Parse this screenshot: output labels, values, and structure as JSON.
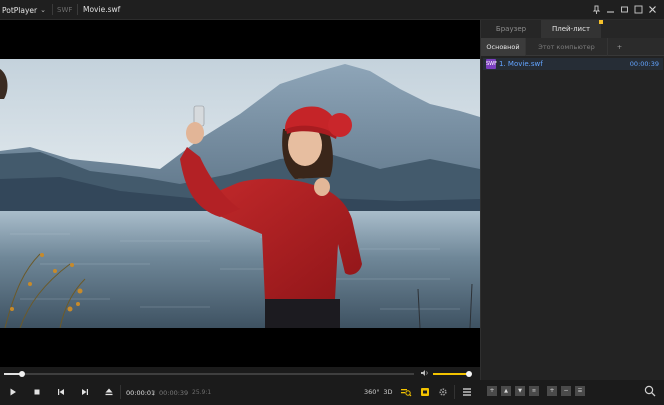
{
  "titlebar": {
    "app_name": "PotPlayer",
    "format": "SWF",
    "filename": "Movie.swf"
  },
  "panel": {
    "tabs": [
      {
        "label": "Браузер"
      },
      {
        "label": "Плей-лист"
      }
    ],
    "subtabs": [
      {
        "label": "Основной"
      },
      {
        "label": "Этот компьютер"
      },
      {
        "label": "+"
      }
    ],
    "playlist": [
      {
        "name": "1. Movie.swf",
        "duration": "00:00:39",
        "icon_label": "SWF"
      }
    ]
  },
  "player": {
    "current_time": "00:00:01",
    "separator": "/",
    "total_time": "00:00:39",
    "frame_info": "25.9:1",
    "progress_fraction": 0.045,
    "volume_fraction": 0.95,
    "mode_labels": {
      "three_sixty": "360°",
      "three_d": "3D"
    }
  },
  "colors": {
    "accent": "#f3c300",
    "playlist_text": "#63a4ff",
    "swf_icon": "#7b3fbf"
  }
}
